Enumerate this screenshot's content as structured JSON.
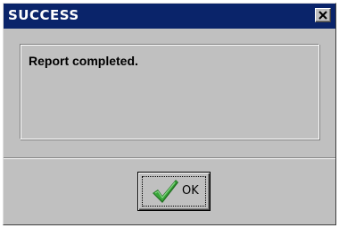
{
  "dialog": {
    "title": "SUCCESS",
    "message": "Report completed.",
    "ok_label": "OK",
    "icons": {
      "close": "close-icon",
      "ok": "checkmark-icon"
    },
    "colors": {
      "titlebar": "#0a246a",
      "face": "#c0c0c0",
      "checkmark": "#2e8b2e"
    }
  }
}
